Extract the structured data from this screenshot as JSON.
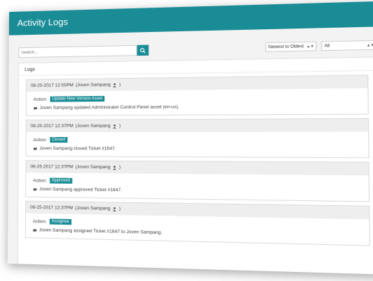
{
  "header": {
    "title": "Activity Logs"
  },
  "search": {
    "placeholder": "Search..."
  },
  "filters": {
    "sort_selected": "Newest to Oldest",
    "type_selected": "All"
  },
  "panel": {
    "title": "Logs"
  },
  "logs": [
    {
      "datetime": "08-25-2017 12:50PM",
      "user": "(Joven Sampang",
      "action_label": "Action:",
      "action": "Update New Version Asset",
      "description": "Joven Sampang updated Administrator Control Panel asset (en-us)."
    },
    {
      "datetime": "08-25-2017 12:37PM",
      "user": "(Joven Sampang",
      "action_label": "Action:",
      "action": "Closed",
      "description": "Joven Sampang closed Ticket #1647."
    },
    {
      "datetime": "08-25-2017 12:37PM",
      "user": "(Joven Sampang",
      "action_label": "Action:",
      "action": "Approved",
      "description": "Joven Sampang approved Ticket #1647."
    },
    {
      "datetime": "08-25-2017 12:37PM",
      "user": "(Joven Sampang",
      "action_label": "Action:",
      "action": "Assignee",
      "description": "Joven Sampang assigned Ticket #1647 to Joven Sampang."
    }
  ],
  "colors": {
    "accent": "#1a8c96"
  },
  "icons": {
    "search": "search-icon",
    "user": "user-icon",
    "comment": "comment-icon"
  }
}
